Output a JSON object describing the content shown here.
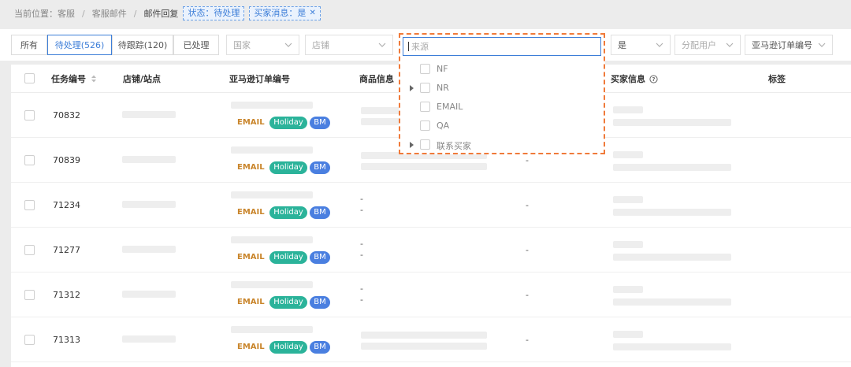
{
  "breadcrumb": {
    "prefix": "当前位置：",
    "items": [
      "客服",
      "客服邮件",
      "邮件回复"
    ],
    "tags": [
      {
        "label": "状态：待处理",
        "closable": false
      },
      {
        "label": "买家消息：是",
        "closable": true
      }
    ]
  },
  "status_tabs": [
    "所有",
    "待处理(526)",
    "待跟踪(120)",
    "已处理"
  ],
  "active_tab": "待处理(526)",
  "filters": {
    "country_placeholder": "国家",
    "shop_placeholder": "店铺",
    "buyer_message_value": "是",
    "assign_user_placeholder": "分配用户",
    "amazon_order_placeholder": "亚马逊订单编号"
  },
  "columns": {
    "task_no": "任务编号",
    "shop_site": "店铺/站点",
    "amazon_order": "亚马逊订单编号",
    "product_info": "商品信息",
    "buyer_info": "买家信息",
    "tags": "标签"
  },
  "rows": [
    {
      "id": "70832",
      "source": "EMAIL",
      "tags": [
        "Holiday",
        "BM"
      ],
      "product_dash": false,
      "col5_dash": false
    },
    {
      "id": "70839",
      "source": "EMAIL",
      "tags": [
        "Holiday",
        "BM"
      ],
      "product_dash": false,
      "col5_dash": true
    },
    {
      "id": "71234",
      "source": "EMAIL",
      "tags": [
        "Holiday",
        "BM"
      ],
      "product_dash": true,
      "col5_dash": true
    },
    {
      "id": "71277",
      "source": "EMAIL",
      "tags": [
        "Holiday",
        "BM"
      ],
      "product_dash": true,
      "col5_dash": true
    },
    {
      "id": "71312",
      "source": "EMAIL",
      "tags": [
        "Holiday",
        "BM"
      ],
      "product_dash": true,
      "col5_dash": true
    },
    {
      "id": "71313",
      "source": "EMAIL",
      "tags": [
        "Holiday",
        "BM"
      ],
      "product_dash": false,
      "col5_dash": true
    }
  ],
  "dash_text": "-",
  "source_dropdown": {
    "placeholder": "来源",
    "options": [
      {
        "label": "NF",
        "expandable": false
      },
      {
        "label": "NR",
        "expandable": true
      },
      {
        "label": "EMAIL",
        "expandable": false
      },
      {
        "label": "QA",
        "expandable": false
      },
      {
        "label": "联系买家",
        "expandable": true
      }
    ]
  },
  "colors": {
    "accent": "#3d7ed8",
    "holiday": "#2bb39a",
    "bm": "#4a7fe0",
    "email": "#c9852b",
    "highlight": "#f07a3a"
  }
}
